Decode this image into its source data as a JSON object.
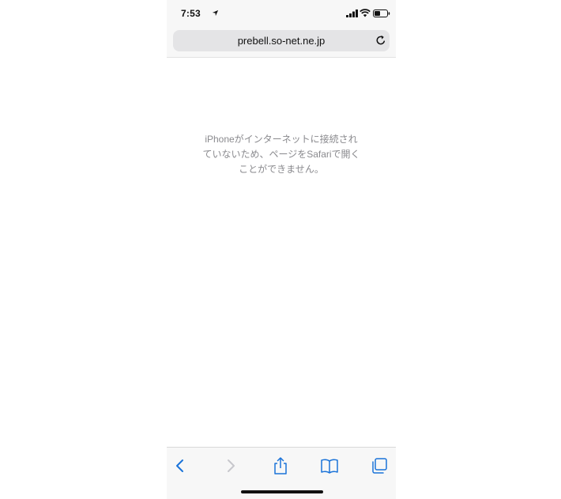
{
  "status_bar": {
    "time": "7:53",
    "icons": [
      "location-arrow-icon",
      "signal-bars-icon",
      "wifi-icon",
      "battery-icon"
    ]
  },
  "address_bar": {
    "url": "prebell.so-net.ne.jp",
    "reload_icon": "reload-icon"
  },
  "page": {
    "message_lines": [
      "iPhoneがインターネットに接続され",
      "ていないため、ページをSafariで開く",
      "ことができません。"
    ]
  },
  "toolbar": {
    "icons": [
      "back-icon",
      "forward-icon",
      "share-icon",
      "bookmarks-icon",
      "tabs-icon"
    ]
  },
  "colors": {
    "accent": "#1a73d9",
    "disabled": "#c7c7cc",
    "message_text": "#8a8a8e",
    "bar_background": "#f7f7f7"
  }
}
